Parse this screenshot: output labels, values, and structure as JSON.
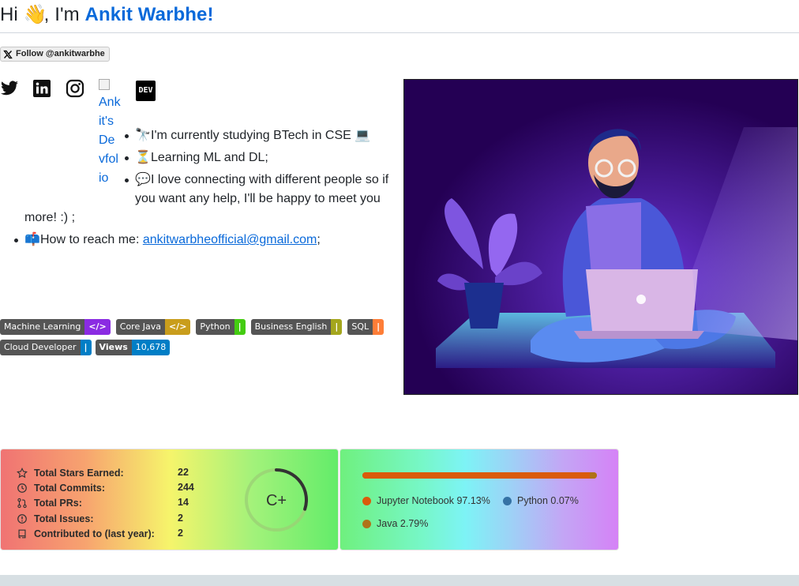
{
  "header": {
    "greeting": "Hi",
    "wave": "👋",
    "intro": ", I'm",
    "name": "Ankit Warbhe!"
  },
  "follow_button": {
    "label": "Follow @ankitwarbhe"
  },
  "social": {
    "dev_label": "DEV",
    "portfolio_alt": "Ankit's Devfolio"
  },
  "bullets": [
    {
      "emoji": "🔭",
      "text": "I'm currently studying BTech in CSE",
      "trail": "💻"
    },
    {
      "emoji": "⏳",
      "text": "Learning ML and DL;"
    },
    {
      "emoji": "💬",
      "text": "I love connecting with different people so if",
      "line2": "you want any help, I'll be happy to meet you",
      "line3": "more! :) ;"
    },
    {
      "emoji": "📫",
      "text": "How to reach me: ",
      "email": "ankitwarbheofficial@gmail.com",
      "tail": ";"
    }
  ],
  "badges": [
    {
      "label": "Machine Learning",
      "value": "</>",
      "color": "#8a2be2"
    },
    {
      "label": "Core Java",
      "value": "</>",
      "color": "#c99d1c"
    },
    {
      "label": "Python",
      "value": "|",
      "color": "#44cc11"
    },
    {
      "label": "Business English",
      "value": "|",
      "color": "#a4a61d"
    },
    {
      "label": "SQL",
      "value": "|",
      "color": "#fe7d37"
    },
    {
      "label": "Cloud Developer",
      "value": "|",
      "color": "#007ec6"
    },
    {
      "label": "Views",
      "value": "10,678",
      "color": "#007ec6"
    }
  ],
  "stats": {
    "rows": [
      {
        "label": "Total Stars Earned:",
        "value": "22",
        "icon": "star-icon"
      },
      {
        "label": "Total Commits:",
        "value": "244",
        "icon": "history-icon"
      },
      {
        "label": "Total PRs:",
        "value": "14",
        "icon": "pull-request-icon"
      },
      {
        "label": "Total Issues:",
        "value": "2",
        "icon": "issue-icon"
      },
      {
        "label": "Contributed to (last year):",
        "value": "2",
        "icon": "repo-icon"
      }
    ],
    "grade": "C+",
    "grade_progress": 0.3
  },
  "languages": {
    "items": [
      {
        "name": "Jupyter Notebook",
        "percent": "97.13%",
        "color": "#DA5B0B"
      },
      {
        "name": "Python",
        "percent": "0.07%",
        "color": "#3572A5"
      },
      {
        "name": "Java",
        "percent": "2.79%",
        "color": "#b07219"
      }
    ]
  }
}
